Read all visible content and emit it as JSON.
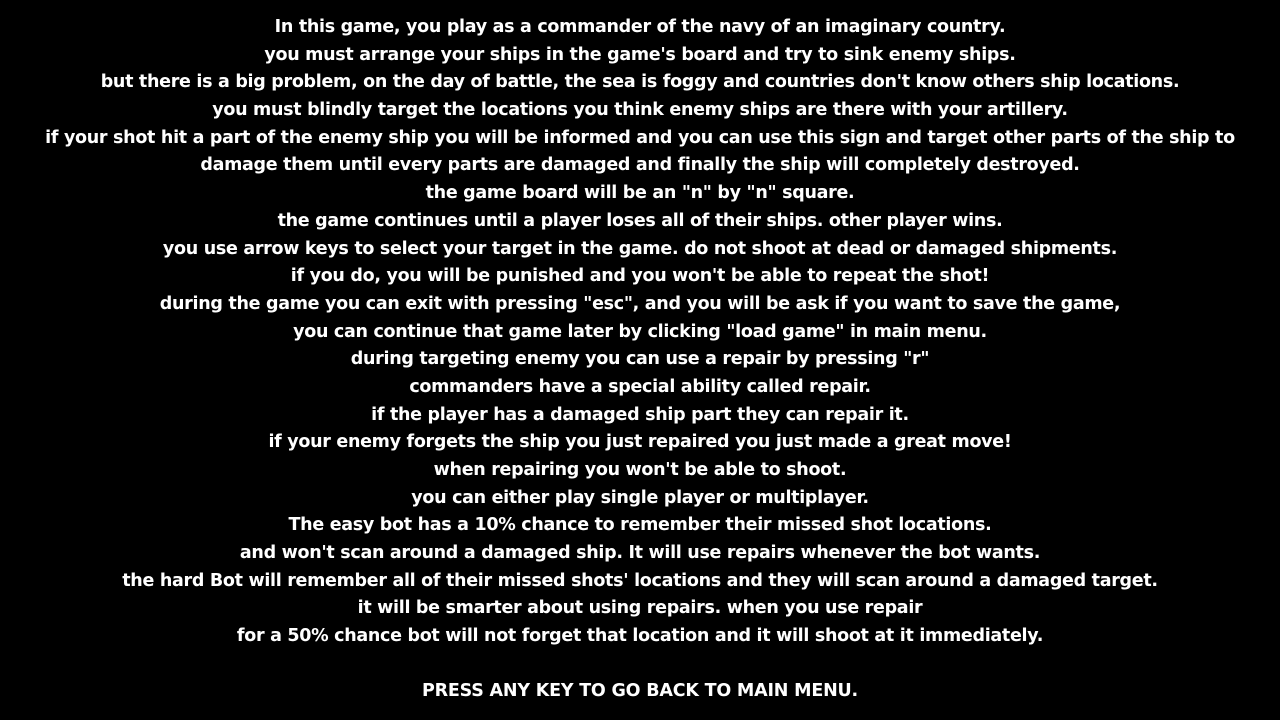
{
  "colors": {
    "background": "#000000",
    "text": "#ffffff"
  },
  "instructions": [
    "In this game, you play as a commander of the navy of an imaginary country.",
    "you must arrange your ships in the game's board and try to sink enemy ships.",
    "but there is a big problem, on the day of battle, the sea is foggy and countries don't know others ship locations.",
    "you must blindly target the locations you think enemy ships are there with your artillery.",
    "if your shot hit a part of the enemy ship you will be informed and you can use this sign and target other parts of the ship to",
    "damage them until every parts are damaged and finally the ship will completely destroyed.",
    "the game board will be an \"n\" by \"n\" square.",
    "the game continues until a player loses all of their ships. other player wins.",
    "you use arrow keys to select your target in the game. do not shoot at dead or damaged shipments.",
    "if you do, you will be punished and you won't be able to repeat the shot!",
    "during the game you can exit with pressing \"esc\", and you will be ask if you want to save the game,",
    "you can continue that game later by clicking \"load game\" in main menu.",
    "during targeting enemy you can use a repair by pressing \"r\"",
    "commanders have a special ability called repair.",
    "if the player has a damaged ship part they can repair it.",
    "if your enemy forgets the ship you just repaired you just made a great move!",
    "when repairing you won't be able to shoot.",
    "you can either play single player or multiplayer.",
    "The easy bot has a 10% chance to remember their missed shot locations.",
    "and won't scan around a damaged ship. It will use repairs whenever the bot wants.",
    "the hard Bot will remember all of their missed shots' locations and they will scan around a damaged target.",
    "it will be smarter about using repairs. when you use repair",
    "for a 50% chance bot will not forget that location and it will shoot at it immediately."
  ],
  "footer": {
    "prompt": "PRESS ANY KEY TO GO BACK TO MAIN MENU."
  }
}
